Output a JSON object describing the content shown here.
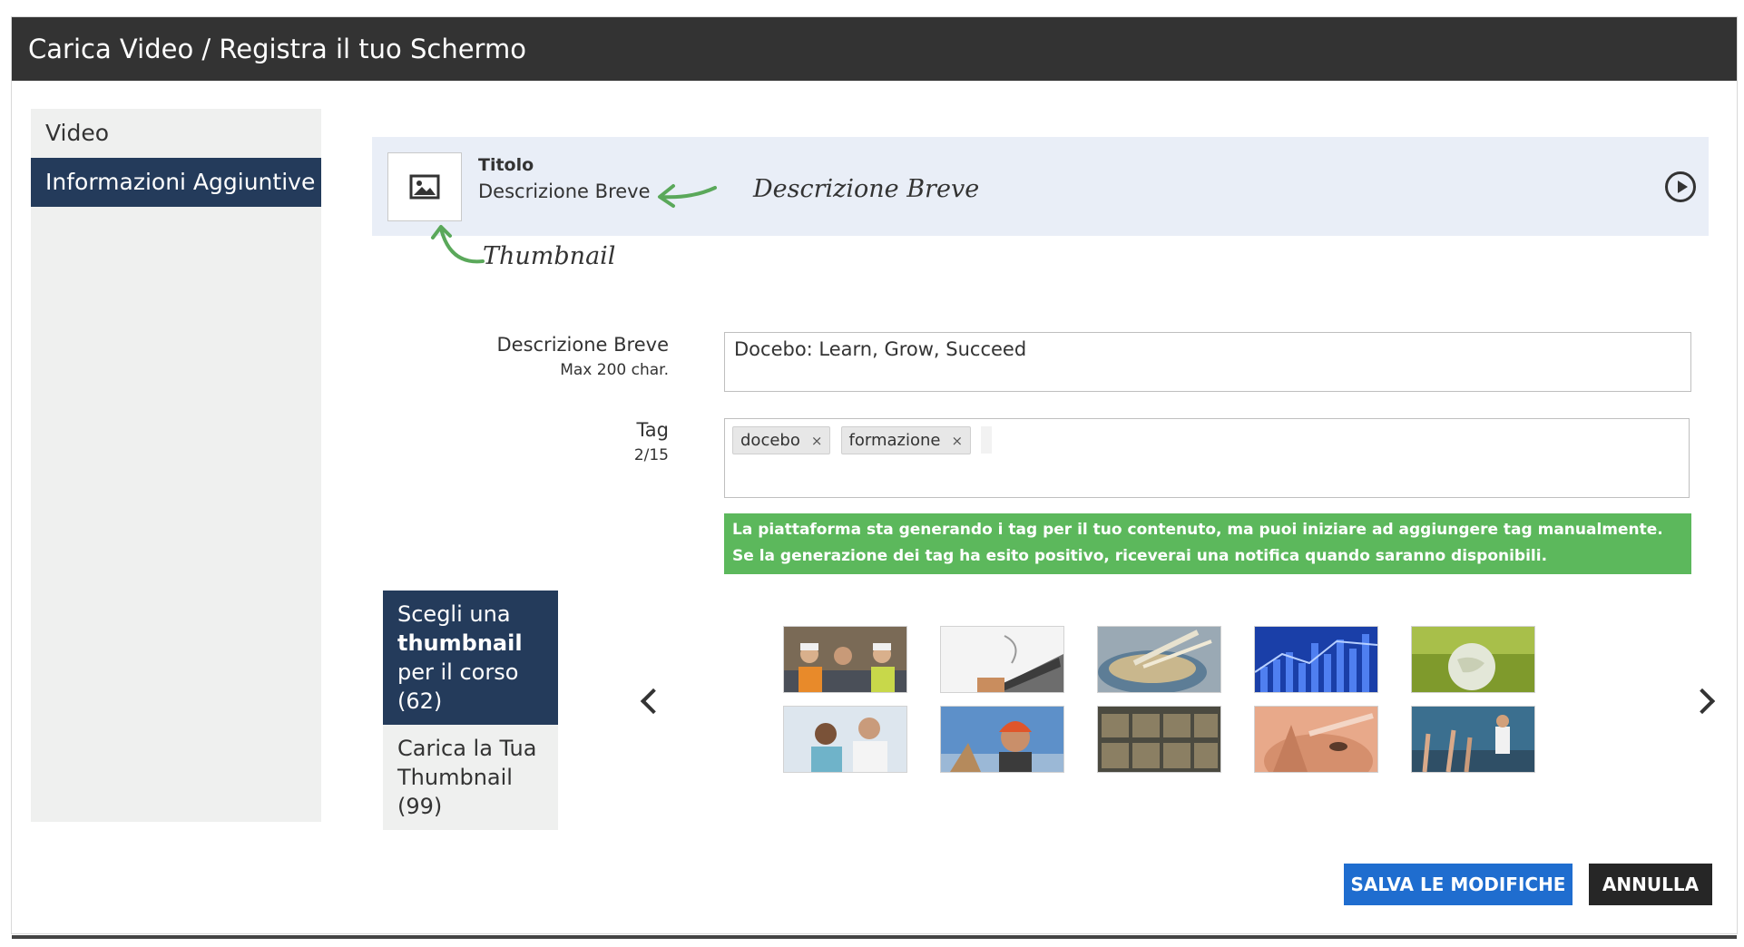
{
  "dialog": {
    "title": "Carica Video / Registra il tuo Schermo"
  },
  "sidebar": {
    "items": [
      {
        "label": "Video"
      },
      {
        "label": "Informazioni Aggiuntive"
      }
    ]
  },
  "preview": {
    "title": "Titolo",
    "short_description": "Descrizione Breve",
    "annotation_description": "Descrizione Breve",
    "annotation_thumbnail": "Thumbnail"
  },
  "form": {
    "short_description": {
      "label": "Descrizione Breve",
      "hint": "Max 200 char.",
      "value": "Docebo: Learn, Grow, Succeed"
    },
    "tags": {
      "label": "Tag",
      "count": "2/15",
      "items": [
        "docebo",
        "formazione"
      ],
      "remove_glyph": "×"
    },
    "notice": "La piattaforma sta generando i tag per il tuo contenuto, ma puoi iniziare ad aggiungere tag manualmente. Se la generazione dei tag ha esito positivo, riceverai una notifica quando saranno disponibili."
  },
  "thumbnail_panel": {
    "tabs": [
      {
        "prefix": "Scegli una ",
        "bold": "thumbnail",
        "suffix": " per il corso (62)"
      },
      {
        "prefix": "Carica la Tua Thumbnail (99)",
        "bold": "",
        "suffix": ""
      }
    ],
    "images": [
      "construction-workers",
      "laptop-hand",
      "wheat-bowl",
      "blue-chart",
      "green-globe",
      "scientists",
      "worker-helmet",
      "warehouse",
      "thinking-face",
      "classroom"
    ]
  },
  "actions": {
    "save": "SALVA LE MODIFICHE",
    "cancel": "ANNULLA"
  },
  "colors": {
    "title_bar": "#333333",
    "accent_navy": "#243b5b",
    "save_blue": "#1f6dcf",
    "notice_green": "#5cb85c",
    "annotation_green": "#5aa85a"
  }
}
